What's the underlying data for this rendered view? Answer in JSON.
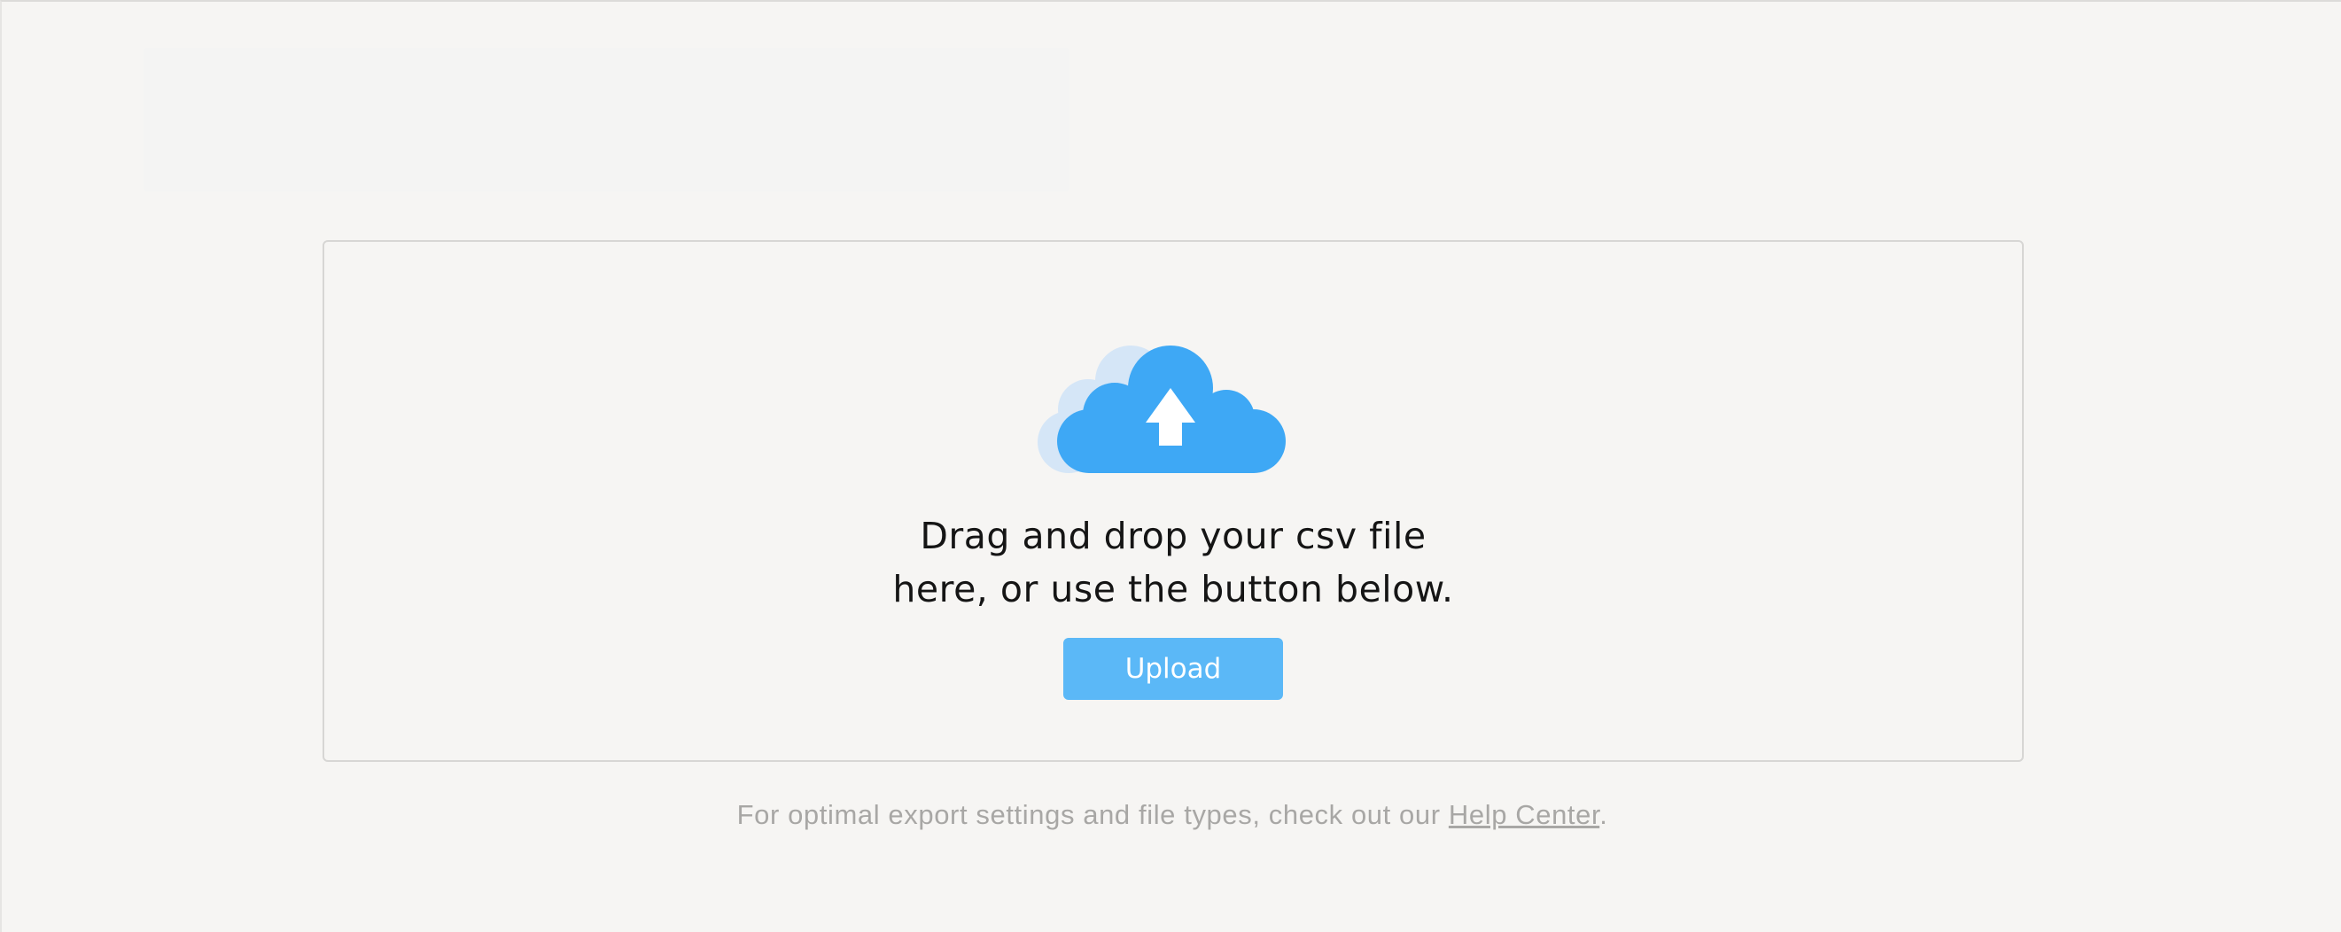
{
  "dropzone": {
    "instruction_line1": "Drag and drop your csv file",
    "instruction_line2": "here, or use the button below.",
    "upload_label": "Upload",
    "cloud_icon": "cloud-upload-icon",
    "colors": {
      "cloud_front": "#3ea8f5",
      "cloud_back": "#d5e6f7",
      "button": "#5bb8f7"
    }
  },
  "footer": {
    "text_before": "For optimal export settings and file types, check out our ",
    "link_label": "Help Center",
    "text_after": "."
  }
}
